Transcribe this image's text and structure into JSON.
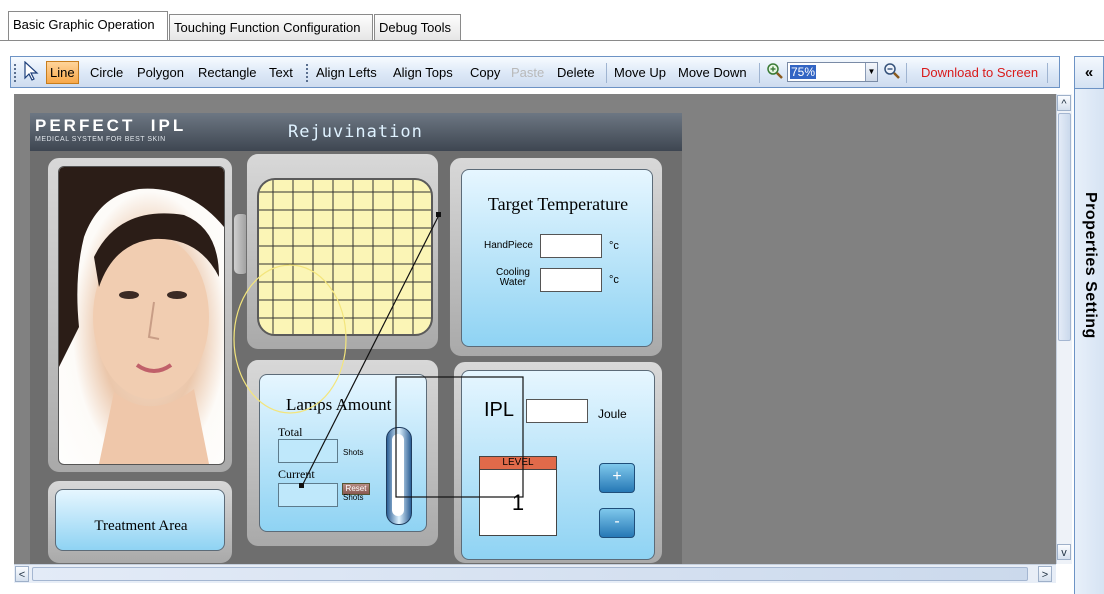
{
  "tabs": [
    {
      "label": "Basic Graphic Operation",
      "active": true
    },
    {
      "label": "Touching Function Configuration",
      "active": false
    },
    {
      "label": "Debug Tools",
      "active": false
    }
  ],
  "toolbar": {
    "line": "Line",
    "circle": "Circle",
    "polygon": "Polygon",
    "rectangle": "Rectangle",
    "text": "Text",
    "align_lefts": "Align Lefts",
    "align_tops": "Align Tops",
    "copy": "Copy",
    "paste": "Paste",
    "delete": "Delete",
    "move_up": "Move Up",
    "move_down": "Move Down",
    "zoom_value": "75%",
    "download": "Download to Screen"
  },
  "side_panel": {
    "collapse": "«",
    "title": "Properties Setting"
  },
  "scrollbars": {
    "up": "^",
    "down": "v",
    "left": "<",
    "right": ">"
  },
  "design": {
    "brand": "PERFECT  IPL",
    "tagline": "MEDICAL SYSTEM FOR BEST SKIN",
    "title": "Rejuvination",
    "treatment_area": "Treatment Area",
    "target_temperature": "Target Temperature",
    "handpiece": "HandPiece",
    "cooling": "Cooling",
    "water": "Water",
    "unit_c": "°c",
    "lamps_amount": "Lamps Amount",
    "total": "Total",
    "current": "Current",
    "shots": "Shots",
    "reset": "Reset",
    "ipl": "IPL",
    "joule": "Joule",
    "level": "LEVEL",
    "level_value": "1",
    "plus": "+",
    "minus": "-"
  },
  "colors": {
    "accent_orange": "#f7a84a",
    "download_red": "#d91a1a",
    "panel_blue": "#8fd3f3"
  }
}
